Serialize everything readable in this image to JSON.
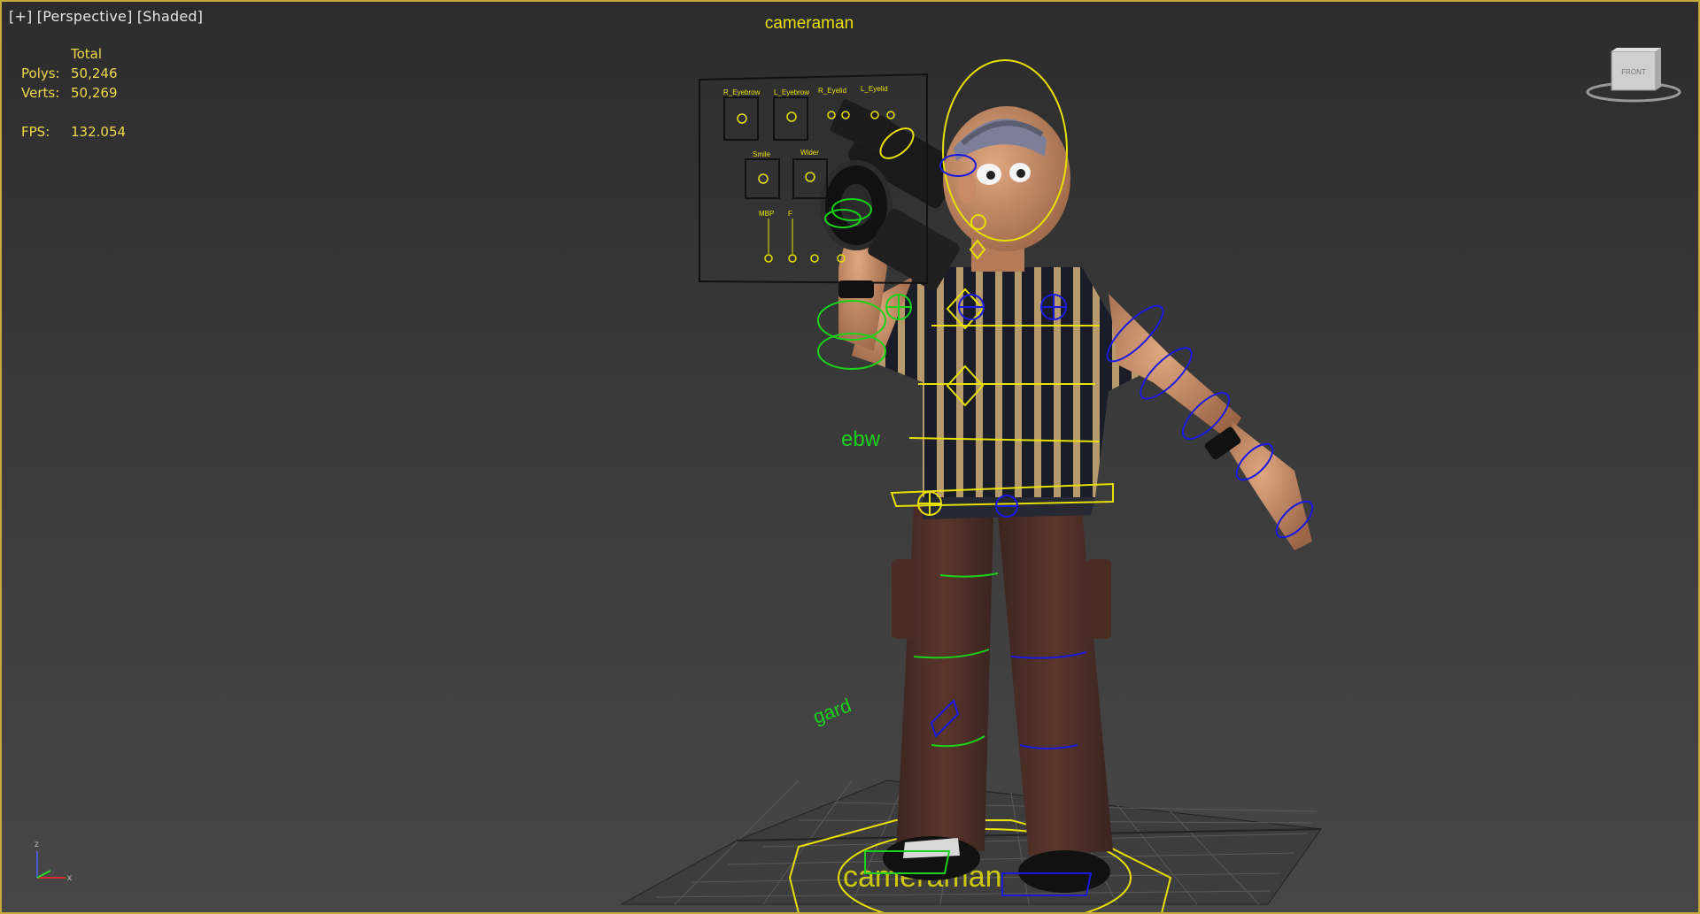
{
  "viewport": {
    "menu_plus": "[+]",
    "view_mode": "[Perspective]",
    "shading_mode": "[Shaded]"
  },
  "stats": {
    "header": "Total",
    "polys_label": "Polys:",
    "polys_value": "50,246",
    "verts_label": "Verts:",
    "verts_value": "50,269",
    "fps_label": "FPS:",
    "fps_value": "132.054"
  },
  "scene": {
    "character_title": "cameraman",
    "floor_text": "cameraman",
    "ebw_label": "ebw",
    "hand_label": "gard"
  },
  "face_panel": {
    "labels": [
      "R_Eyebrow",
      "L_Eyebrow",
      "R_Eyelid",
      "L_Eyelid",
      "Smile",
      "Wider",
      "MBP",
      "F"
    ]
  },
  "viewcube": {
    "face_label": "FRONT"
  },
  "axis": {
    "z": "z",
    "x": "x"
  },
  "colors": {
    "viewport_border": "#c8aa3c",
    "stats_text": "#f0d84a",
    "rig_yellow": "#e8e000",
    "rig_green": "#19d219",
    "rig_blue": "#1a1ae0"
  }
}
